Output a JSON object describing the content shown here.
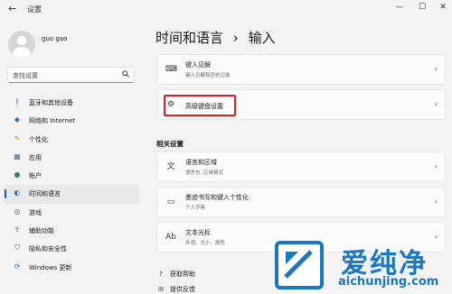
{
  "window": {
    "back_icon": "back-arrow-icon",
    "title": "设置",
    "controls": [
      "minimize-icon",
      "maximize-icon",
      "close-icon"
    ]
  },
  "user": {
    "name": "guo gao"
  },
  "search": {
    "placeholder": "查找设置"
  },
  "sidebar": {
    "accent_color": "#005fb8",
    "items": [
      {
        "label": "蓝牙和其他设备",
        "icon": "bluetooth-icon"
      },
      {
        "label": "网络和 Internet",
        "icon": "network-icon"
      },
      {
        "label": "个性化",
        "icon": "brush-icon"
      },
      {
        "label": "应用",
        "icon": "apps-icon"
      },
      {
        "label": "帐户",
        "icon": "account-icon"
      },
      {
        "label": "时间和语言",
        "icon": "time-language-icon",
        "active": true
      },
      {
        "label": "游戏",
        "icon": "gaming-icon"
      },
      {
        "label": "辅助功能",
        "icon": "accessibility-icon"
      },
      {
        "label": "隐私和安全性",
        "icon": "shield-icon"
      },
      {
        "label": "Windows 更新",
        "icon": "update-icon"
      }
    ]
  },
  "main": {
    "breadcrumb_parent": "时间和语言",
    "breadcrumb_sep": "›",
    "breadcrumb_current": "输入",
    "cards": [
      {
        "title": "键入见解",
        "subtitle": "键入见解和历史记录",
        "icon": "keyboard-icon"
      },
      {
        "title": "高级键盘设置",
        "subtitle": "",
        "icon": "gear-icon",
        "highlighted": true,
        "highlight_color": "#d9211f"
      }
    ],
    "related_heading": "相关设置",
    "related_cards": [
      {
        "title": "语言和区域",
        "subtitle": "语言包, 区域格式",
        "icon": "language-icon"
      },
      {
        "title": "墨迹书写和键入个性化",
        "subtitle": "个人字典",
        "icon": "pen-icon"
      },
      {
        "title": "文本光标",
        "subtitle": "外观、大小、颜色",
        "icon": "text-cursor-icon"
      }
    ],
    "links": [
      {
        "label": "获取帮助",
        "icon": "help-icon"
      },
      {
        "label": "提供反馈",
        "icon": "feedback-icon"
      }
    ]
  },
  "watermark": {
    "text": "爱纯净",
    "url": "aichunjing.com",
    "color": "#1a78c2"
  }
}
